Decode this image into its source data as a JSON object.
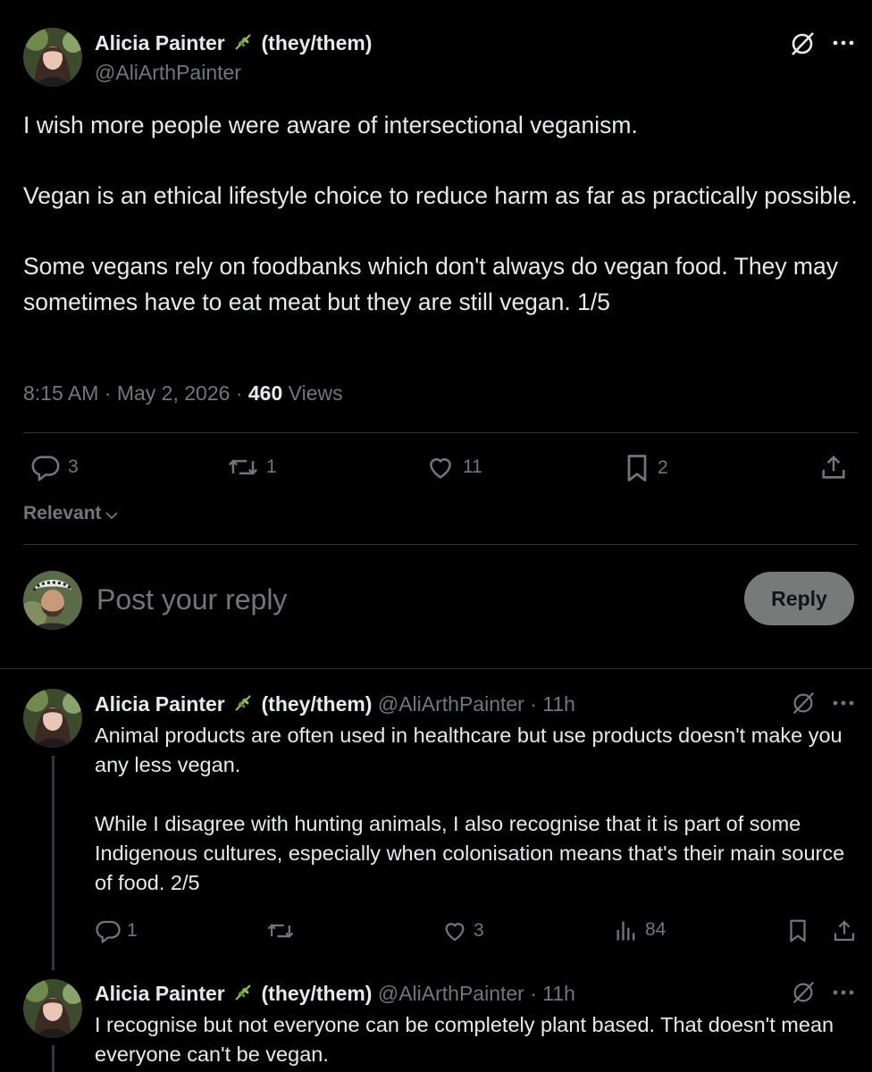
{
  "main_tweet": {
    "author_name": "Alicia Painter",
    "pronouns": "(they/them)",
    "handle": "@AliArthPainter",
    "paragraphs": [
      "I wish more people were aware of intersectional veganism.",
      "Vegan is an ethical lifestyle choice to reduce harm as far as practically possible.",
      "Some vegans rely on foodbanks which don't always do vegan food. They may sometimes have to eat meat but they are still vegan. 1/5"
    ],
    "time": "8:15 AM",
    "date": "May 2, 2026",
    "views_count": "460",
    "views_label": "Views",
    "reply_count": "3",
    "repost_count": "1",
    "like_count": "11",
    "bookmark_count": "2"
  },
  "sort_label": "Relevant",
  "composer": {
    "placeholder": "Post your reply",
    "reply_button": "Reply"
  },
  "thread": [
    {
      "author_name": "Alicia Painter",
      "pronouns": "(they/them)",
      "handle": "@AliArthPainter",
      "age": "11h",
      "paragraphs": [
        "Animal products are often used in healthcare but use products doesn't make you any less vegan.",
        "While I disagree with hunting animals, I also recognise that it is part of some Indigenous cultures, especially when colonisation means that's their main source of food. 2/5"
      ],
      "reply_count": "1",
      "repost_count": "",
      "like_count": "3",
      "views_count": "84"
    },
    {
      "author_name": "Alicia Painter",
      "pronouns": "(they/them)",
      "handle": "@AliArthPainter",
      "age": "11h",
      "paragraphs": [
        "I recognise but not everyone can be completely plant based. That doesn't mean everyone can't be vegan."
      ]
    }
  ],
  "icons": {
    "name_emoji": "herb-icon",
    "grok": "grok-icon",
    "more": "more-icon",
    "reply": "reply-icon",
    "repost": "repost-icon",
    "like": "like-icon",
    "bookmark": "bookmark-icon",
    "share": "share-icon",
    "views": "views-icon",
    "chevron": "chevron-down-icon"
  },
  "colors": {
    "background": "#000000",
    "text": "#e7e9ea",
    "muted": "#71767b",
    "divider": "#2f3336",
    "reply_button_bg": "#787a7a"
  }
}
